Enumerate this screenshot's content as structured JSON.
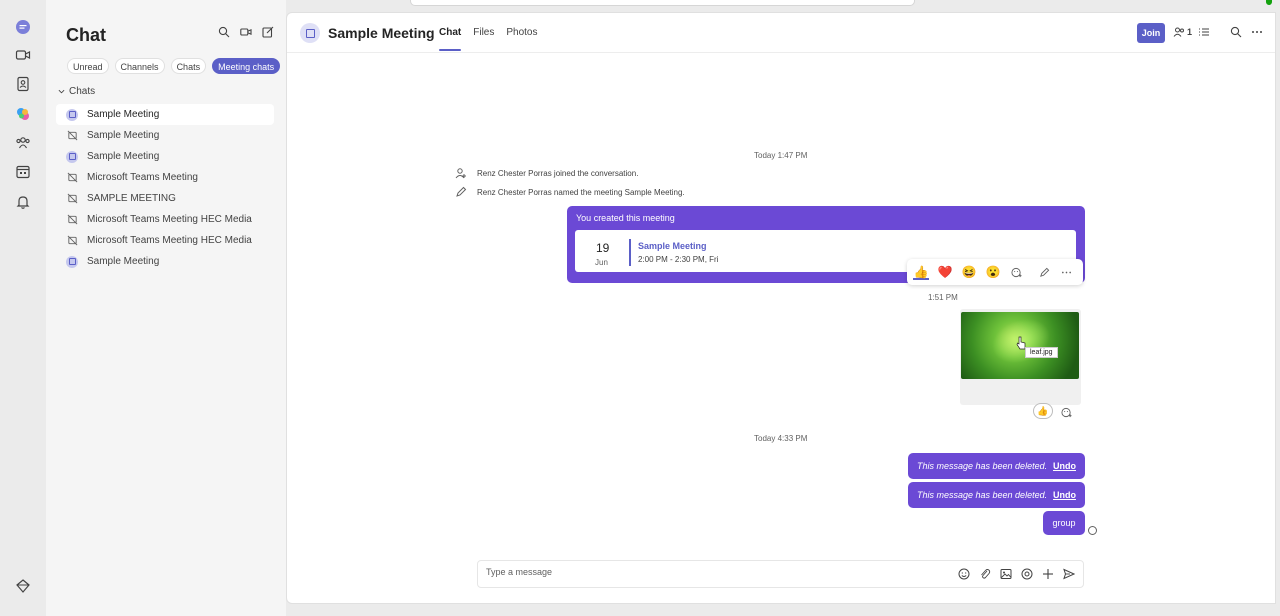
{
  "list": {
    "title": "Chat",
    "filters": [
      "Unread",
      "Channels",
      "Chats",
      "Meeting chats"
    ],
    "section": "Chats",
    "items": [
      {
        "name": "Sample Meeting",
        "icon": "meeting-icon"
      },
      {
        "name": "Sample Meeting",
        "icon": "meeting-off-icon"
      },
      {
        "name": "Sample Meeting",
        "icon": "meeting-icon"
      },
      {
        "name": "Microsoft Teams Meeting",
        "icon": "meeting-off-icon"
      },
      {
        "name": "SAMPLE MEETING",
        "icon": "meeting-off-icon"
      },
      {
        "name": "Microsoft Teams Meeting HEC Media",
        "icon": "meeting-off-icon"
      },
      {
        "name": "Microsoft Teams Meeting HEC Media",
        "icon": "meeting-off-icon"
      },
      {
        "name": "Sample Meeting",
        "icon": "meeting-icon"
      }
    ]
  },
  "header": {
    "title": "Sample Meeting",
    "tabs": [
      "Chat",
      "Files",
      "Photos"
    ],
    "join": "Join",
    "participants": "1"
  },
  "conversation": {
    "stamp1": "Today 1:47 PM",
    "sys1": "Renz Chester Porras joined the conversation.",
    "sys2": "Renz Chester Porras named the meeting Sample Meeting.",
    "card_title": "You created this meeting",
    "card_day": "19",
    "card_month": "Jun",
    "card_meeting": "Sample Meeting",
    "card_time": "2:00 PM - 2:30 PM, Fri",
    "reactions": [
      "👍",
      "❤️",
      "😆",
      "😮"
    ],
    "img_time": "1:51 PM",
    "img_file": "leaf.jpg",
    "img_reaction": "👍",
    "stamp2": "Today 4:33 PM",
    "deleted_text": "This message has been deleted.",
    "undo": "Undo",
    "group_text": "group"
  },
  "compose": {
    "placeholder": "Type a message"
  },
  "colors": {
    "brand": "#5b5fc7",
    "bubble": "#6b49d5"
  }
}
